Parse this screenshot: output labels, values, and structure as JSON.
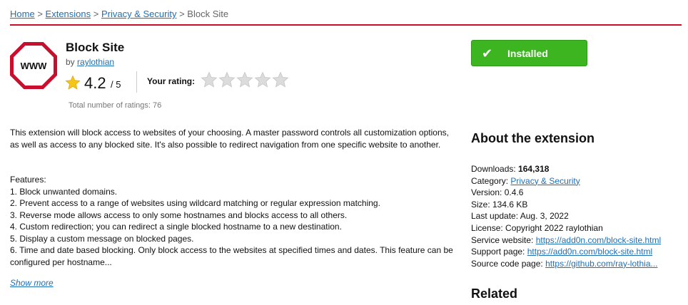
{
  "breadcrumb": {
    "home": "Home",
    "extensions": "Extensions",
    "category": "Privacy & Security",
    "current": "Block Site",
    "separator": ">"
  },
  "extension": {
    "logo_text": "WWW",
    "title": "Block Site",
    "by_prefix": "by",
    "author": "raylothian",
    "rating": "4.2",
    "rating_max": "/ 5",
    "your_rating_label": "Your rating:",
    "your_rating_stars": 0,
    "total_ratings": "Total number of ratings: 76"
  },
  "install_button": {
    "label": "Installed",
    "icon": "check-icon",
    "color": "#3cb521"
  },
  "description": {
    "intro": "This extension will block access to websites of your choosing. A master password controls all customization options, as well as access to any blocked site. It's also possible to redirect navigation from one specific website to another.",
    "features_heading": "Features:",
    "features": [
      "1. Block unwanted domains.",
      "2. Prevent access to a range of websites using wildcard matching or regular expression matching.",
      "3. Reverse mode allows access to only some hostnames and blocks access to all others.",
      "4. Custom redirection; you can redirect a single blocked hostname to a new destination.",
      "5. Display a custom message on blocked pages.",
      "6. Time and date based blocking. Only block access to the websites at specified times and dates. This feature can be configured per hostname..."
    ],
    "show_more": "Show more"
  },
  "about": {
    "heading": "About the extension",
    "downloads_label": "Downloads:",
    "downloads_value": "164,318",
    "category_label": "Category:",
    "category_value": "Privacy & Security",
    "version": "Version: 0.4.6",
    "size": "Size: 134.6 KB",
    "last_update": "Last update: Aug. 3, 2022",
    "license": "License: Copyright 2022 raylothian",
    "service_label": "Service website:",
    "service_value": "https://add0n.com/block-site.html",
    "support_label": "Support page:",
    "support_value": "https://add0n.com/block-site.html",
    "source_label": "Source code page:",
    "source_value": "https://github.com/ray-lothia..."
  },
  "related": {
    "heading": "Related"
  },
  "colors": {
    "accent_rule": "#c8102e",
    "link": "#1f6fb5",
    "star_filled": "#f5c518",
    "star_empty": "#d6d6d6"
  }
}
